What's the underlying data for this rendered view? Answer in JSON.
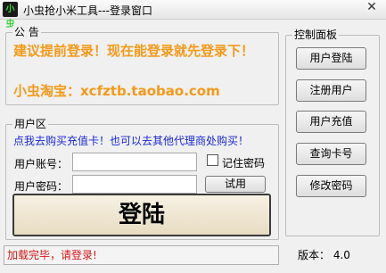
{
  "window": {
    "icon_text": "小虫",
    "title": "小虫抢小米工具---登录窗口",
    "close_glyph": "✕"
  },
  "notice": {
    "group_title": "公 告",
    "line1": "建议提前登录！现在能登录就先登录下！",
    "line2": "小虫淘宝：xcfztb.taobao.com"
  },
  "user_area": {
    "group_title": "用户区",
    "hint": "点我去购买充值卡！也可以去其他代理商处购买！",
    "account_label": "用户账号：",
    "account_value": "",
    "password_label": "用户密码：",
    "password_value": "",
    "remember_label": "记住密码",
    "remember_checked": false,
    "trial_button": "试用",
    "login_button": "登陆"
  },
  "control_panel": {
    "group_title": "控制面板",
    "buttons": [
      "用户登陆",
      "注册用户",
      "用户充值",
      "查询卡号",
      "修改密码"
    ]
  },
  "status": {
    "text": "加载完毕，请登录!",
    "version": "版本： 4.0"
  },
  "colors": {
    "notice_text": "#f39a1a",
    "hint_text": "#1a2ad6",
    "status_text": "#d61818"
  }
}
